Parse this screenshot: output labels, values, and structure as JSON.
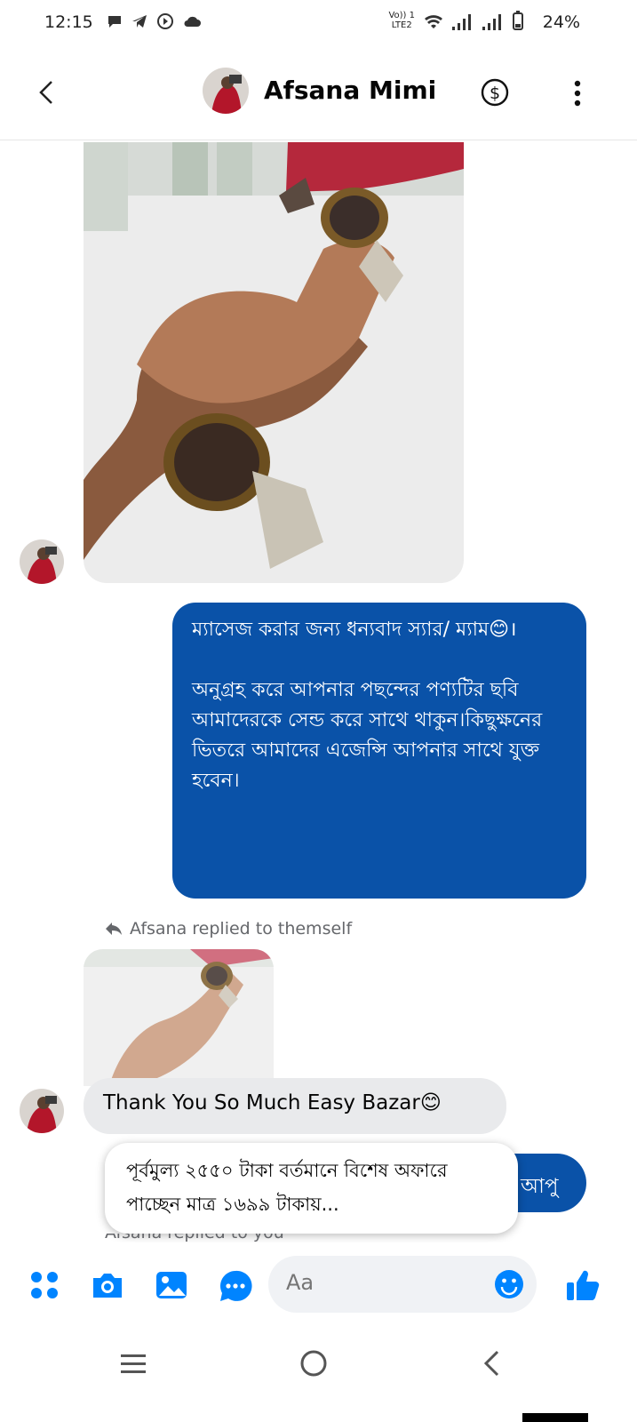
{
  "status_bar": {
    "time": "12:15",
    "network_label_top": "Vo)) 1",
    "network_label_bottom": "LTE2",
    "battery": "24%"
  },
  "header": {
    "contact_name": "Afsana Mimi"
  },
  "messages": {
    "outgoing_paragraph_1": "ম্যাসেজ করার জন্য ধন্যবাদ স্যার/ ম্যাম😊।",
    "outgoing_paragraph_2": "অনুগ্রহ করে আপনার পছন্দের পণ্যটির ছবি আমাদেরকে সেন্ড করে সাথে থাকুন।কিছুক্ষনের ভিতরে আমাদের এজেন্সি আপনার সাথে যুক্ত হবেন।",
    "reply_label": "Afsana replied to themself",
    "incoming_text": "Thank You So Much Easy Bazar😊",
    "apu_text": "আপু",
    "popup_text": "পূর্বমুল্য ২৫৫০ টাকা বর্তমানে বিশেষ অফারে পাচ্ছেন মাত্র ১৬৯৯ টাকায়...",
    "cut_label": "Afsana replied to you"
  },
  "composer": {
    "placeholder": "Aa"
  },
  "colors": {
    "accent": "#0a52a8",
    "messenger_blue": "#0084ff",
    "incoming_bubble": "#e9eaec"
  },
  "icons": {
    "apps": "apps-icon",
    "camera": "camera-icon",
    "gallery": "gallery-icon",
    "chat": "chat-bubble-icon",
    "emoji": "emoji-icon",
    "like": "thumbs-up-icon"
  }
}
